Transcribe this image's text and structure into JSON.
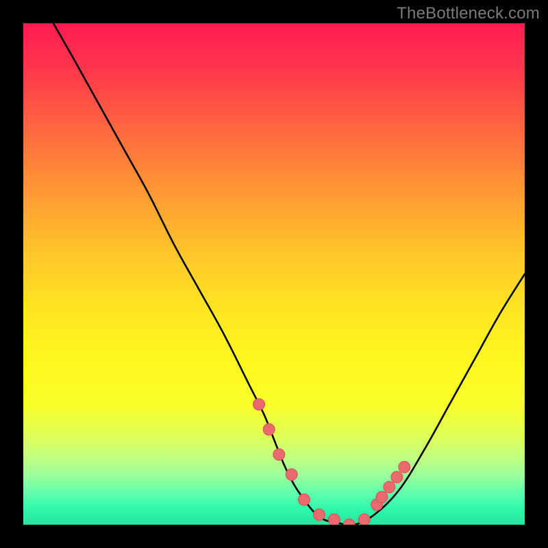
{
  "watermark": "TheBottleneck.com",
  "colors": {
    "background": "#000000",
    "curve": "#000000",
    "marker_fill": "#e86a6d",
    "marker_stroke": "#d84f55",
    "gradient_top": "#ff1a52",
    "gradient_bottom": "#28e6a0"
  },
  "chart_data": {
    "type": "line",
    "title": "",
    "xlabel": "",
    "ylabel": "",
    "xlim": [
      0,
      100
    ],
    "ylim": [
      0,
      100
    ],
    "grid": false,
    "legend": false,
    "series": [
      {
        "name": "bottleneck-curve",
        "x": [
          6,
          10,
          15,
          20,
          25,
          30,
          35,
          40,
          45,
          48,
          50,
          52,
          54,
          56,
          58,
          60,
          63,
          66,
          70,
          75,
          80,
          85,
          90,
          95,
          100
        ],
        "values": [
          100,
          93,
          84,
          75,
          66,
          56,
          47,
          38,
          28,
          22,
          17,
          12,
          8,
          5,
          2.5,
          1,
          0.3,
          0,
          2,
          7,
          15,
          24,
          33,
          42,
          50
        ]
      }
    ],
    "markers": {
      "name": "highlighted-points",
      "x": [
        47,
        49,
        51,
        53.5,
        56,
        59,
        62,
        65,
        68,
        70.5,
        71.5,
        73,
        74.5,
        76
      ],
      "values": [
        24,
        19,
        14,
        10,
        5,
        2,
        1,
        0,
        1,
        4,
        5.5,
        7.5,
        9.5,
        11.5
      ]
    }
  }
}
